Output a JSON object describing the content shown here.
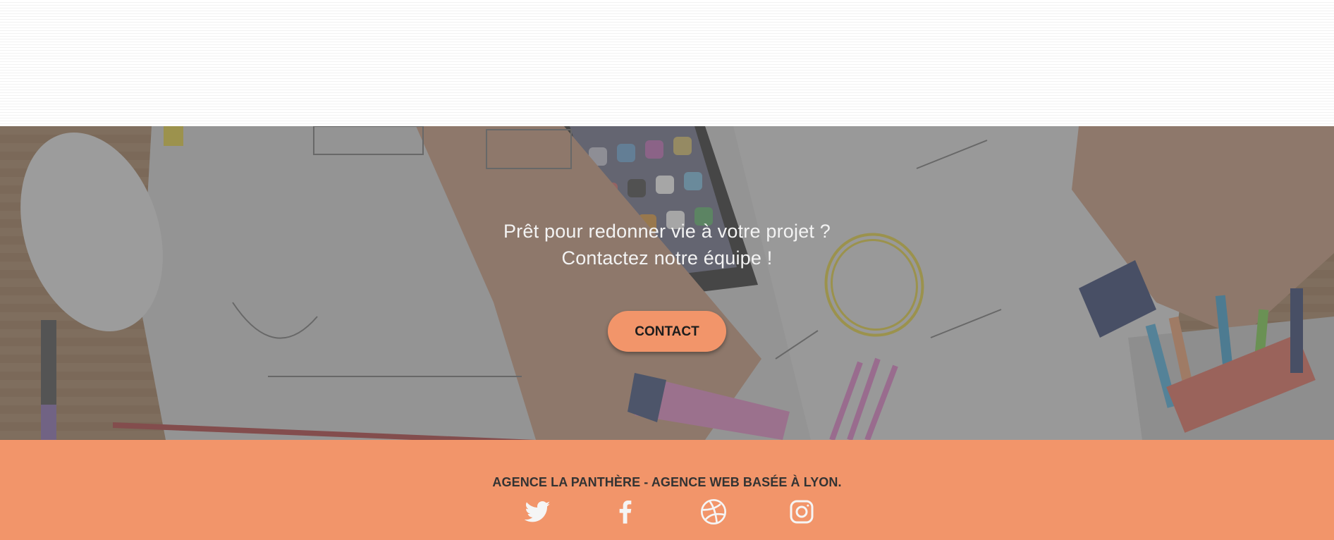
{
  "hero": {
    "line1": "Prêt pour redonner vie à votre projet ?",
    "line2": "Contactez notre équipe !",
    "button_label": "CONTACT"
  },
  "footer": {
    "tagline": "AGENCE LA PANTHÈRE - AGENCE WEB BASÉE À LYON.",
    "social": [
      "twitter-icon",
      "facebook-icon",
      "dribbble-icon",
      "instagram-icon"
    ]
  },
  "colors": {
    "accent": "#f2956a",
    "footer_text": "#333333",
    "hero_text": "#f3f3f3",
    "icon": "#f5f5f5"
  }
}
